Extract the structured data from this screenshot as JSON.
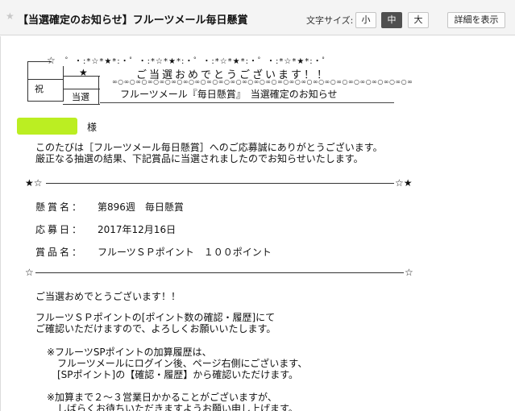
{
  "header": {
    "star_glyph": "★",
    "title": "【当選確定のお知らせ】フルーツメール毎日懸賞",
    "font_size_label": "文字サイズ:",
    "font_sizes": [
      "小",
      "中",
      "大"
    ],
    "font_size_selected": "中",
    "details_button": "詳細を表示"
  },
  "email": {
    "logo": {
      "glyph_celebrate": "祝",
      "glyph_win": "当選",
      "star_outline": "☆",
      "star_filled": "★"
    },
    "ornament": "゜・:*☆*★*:・゜・:*☆*★*:・゜・:*☆*★*:・゜・:*☆*★*:・゜",
    "banner": "ご当選おめでとうございます！！",
    "dotrow": "∞○∞○∞○∞○∞○∞○∞○∞○∞○∞○∞○∞○∞○∞○∞○∞○∞○∞○∞○∞○∞○∞○∞○∞○∞○∞",
    "subtitle": "フルーツメール『毎日懸賞』　当選確定のお知らせ",
    "recipient_suffix": "様",
    "intro_line1": "このたびは［フルーツメール毎日懸賞］へのご応募誠にありがとうございます。",
    "intro_line2": "厳正なる抽選の結果、下記賞品に当選されましたのでお知らせいたします。",
    "rule_star_left": "★☆",
    "rule_star_right": "☆★",
    "prize_fields": [
      {
        "label": "懸賞名：",
        "value": "第896週　毎日懸賞"
      },
      {
        "label": "応募日：",
        "value": "2017年12月16日"
      },
      {
        "label": "賞品名：",
        "value": "フルーツＳＰポイント　１００ポイント"
      }
    ],
    "rule2_star": "☆",
    "congrats": "ご当選おめでとうございます！！",
    "points_line1": "フルーツＳＰポイントの[ポイント数の確認・履歴]にて",
    "points_line2": "ご確認いただけますので、よろしくお願いいたします。",
    "note1_line1": "※フルーツSPポイントの加算履歴は、",
    "note1_line2": "フルーツメールにログイン後、ページ右側にございます、",
    "note1_line3": "[SPポイント]の【確認・履歴】から確認いただけます。",
    "note2_line1": "※加算まで２～３営業日かかることがございますが、",
    "note2_line2": "しばらくお待ちいただきますようお願い申し上げます。"
  }
}
